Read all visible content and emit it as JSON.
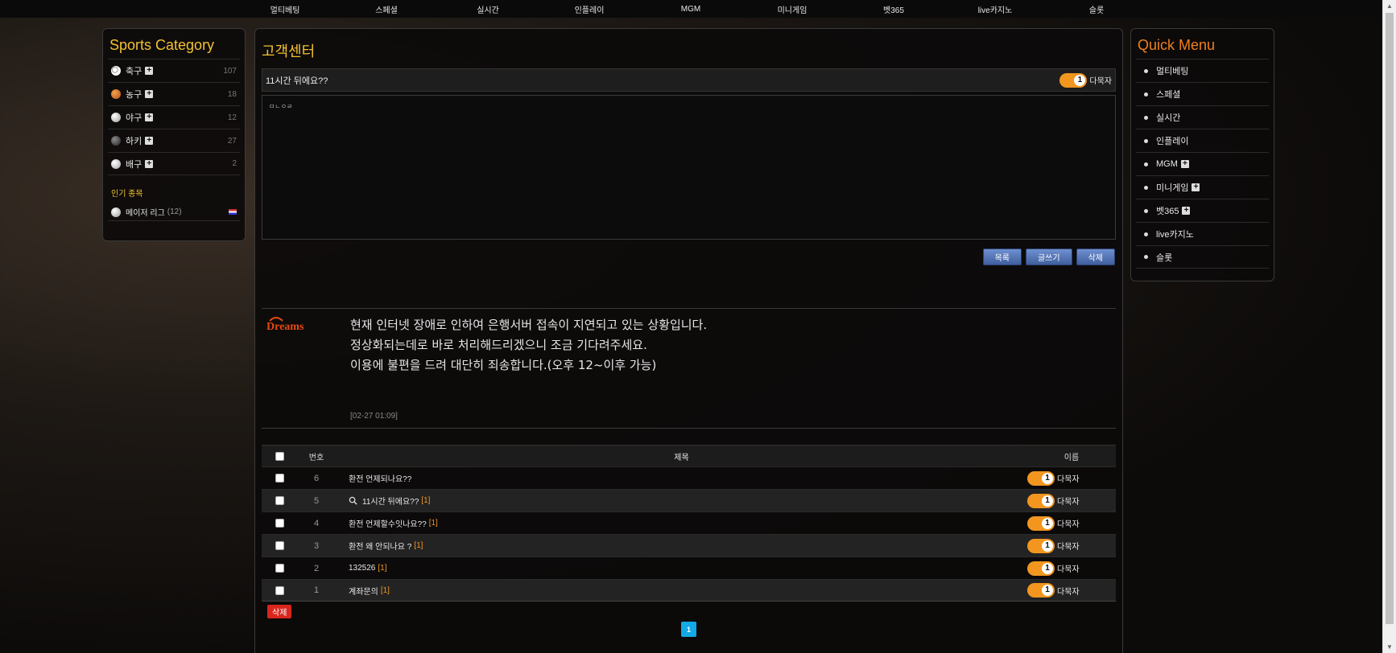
{
  "topnav": [
    "멀티베팅",
    "스페셜",
    "실시간",
    "인플레이",
    "MGM",
    "미니게임",
    "벳365",
    "live카지노",
    "슬롯"
  ],
  "sports": {
    "title": "Sports Category",
    "items": [
      {
        "name": "축구",
        "count": "107",
        "icon": "soccer-ball-icon"
      },
      {
        "name": "농구",
        "count": "18",
        "icon": "basketball-icon"
      },
      {
        "name": "야구",
        "count": "12",
        "icon": "baseball-icon"
      },
      {
        "name": "하키",
        "count": "27",
        "icon": "hockey-puck-icon"
      },
      {
        "name": "배구",
        "count": "2",
        "icon": "volleyball-icon"
      }
    ],
    "popular_title": "인기 종목",
    "popular": {
      "name": "메이저 리그",
      "count": "(12)"
    }
  },
  "quick": {
    "title": "Quick Menu",
    "items": [
      {
        "label": "멀티베팅",
        "plus": false
      },
      {
        "label": "스페셜",
        "plus": false
      },
      {
        "label": "실시간",
        "plus": false
      },
      {
        "label": "인플레이",
        "plus": false
      },
      {
        "label": "MGM",
        "plus": true
      },
      {
        "label": "미니게임",
        "plus": true
      },
      {
        "label": "벳365",
        "plus": true
      },
      {
        "label": "live카지노",
        "plus": false
      },
      {
        "label": "슬롯",
        "plus": false
      }
    ]
  },
  "main": {
    "title": "고객센터",
    "post": {
      "title": "11시간 뒤에요??",
      "level": "1",
      "author": "다묵자",
      "body": "ㅁㄴㅇㄹ"
    },
    "buttons": {
      "list": "목록",
      "write": "글쓰기",
      "delete": "삭제"
    },
    "reply": {
      "logo": "Dreams",
      "lines": [
        "현재 인터넷 장애로 인하여 은행서버 접속이 지연되고 있는 상황입니다.",
        "정상화되는데로 바로 처리해드리겠으니 조금 기다려주세요.",
        "이용에 불편을 드려 대단히 죄송합니다.(오후 12~이후 가능)"
      ],
      "time": "[02-27 01:09]"
    },
    "board": {
      "headers": {
        "num": "번호",
        "subject": "제목",
        "name": "이름"
      },
      "rows": [
        {
          "num": "6",
          "subject": "환전 언제되나요??",
          "comments": "",
          "icon": false,
          "level": "1",
          "author": "다묵자"
        },
        {
          "num": "5",
          "subject": "11시간 뒤에요??",
          "comments": "[1]",
          "icon": true,
          "level": "1",
          "author": "다묵자"
        },
        {
          "num": "4",
          "subject": "환전 언제할수잇나요??",
          "comments": "[1]",
          "icon": false,
          "level": "1",
          "author": "다묵자"
        },
        {
          "num": "3",
          "subject": "환전 왜 안되나요 ?",
          "comments": "[1]",
          "icon": false,
          "level": "1",
          "author": "다묵자"
        },
        {
          "num": "2",
          "subject": "132526",
          "comments": "[1]",
          "icon": false,
          "level": "1",
          "author": "다묵자"
        },
        {
          "num": "1",
          "subject": "계좌문의",
          "comments": "[1]",
          "icon": false,
          "level": "1",
          "author": "다묵자"
        }
      ]
    },
    "delete_label": "삭제",
    "page": "1"
  }
}
